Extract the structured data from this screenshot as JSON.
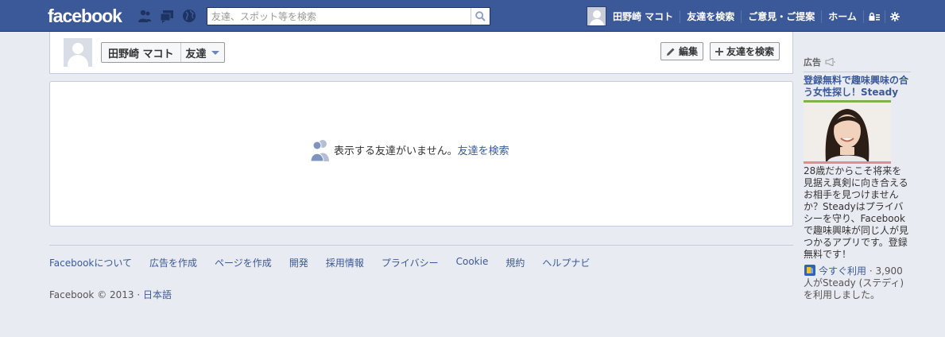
{
  "topbar": {
    "logo": "facebook",
    "search_placeholder": "友達、スポット等を検索",
    "user_name": "田野崎 マコト",
    "nav_find_friends": "友達を検索",
    "nav_feedback": "ご意見・ご提案",
    "nav_home": "ホーム"
  },
  "profile": {
    "name": "田野崎 マコト",
    "section_label": "友達",
    "edit_label": "編集",
    "find_friends_label": "友達を検索"
  },
  "content": {
    "empty_text": "表示する友達がいません。",
    "find_link": "友達を検索"
  },
  "footer": {
    "links": [
      "Facebookについて",
      "広告を作成",
      "ページを作成",
      "開発",
      "採用情報",
      "プライバシー",
      "Cookie",
      "規約",
      "ヘルプナビ"
    ],
    "copyright": "Facebook © 2013 · ",
    "language": "日本語"
  },
  "ad": {
    "header": "広告",
    "title": "登録無料で趣味興味の合う女性探し！Steady",
    "body": "28歳だからこそ将来を見据え真剣に向き合えるお相手を見つけませんか？Steadyはプライバシーを守り、Facebookで趣味興味が同じ人が見つかるアプリです。登録無料です！",
    "social_link": "今すぐ利用",
    "social_text": " · 3,900人がSteady (ステディ) を利用しました。"
  },
  "colors": {
    "brand": "#3b5998",
    "page_bg": "#e9ebf2",
    "link": "#3b5998"
  },
  "icons": [
    "friend-requests-icon",
    "messages-icon",
    "notifications-globe-icon",
    "search-icon",
    "privacy-lock-icon",
    "gear-icon",
    "pencil-icon",
    "plus-icon",
    "friends-silhouette-icon",
    "megaphone-icon",
    "app-icon"
  ]
}
